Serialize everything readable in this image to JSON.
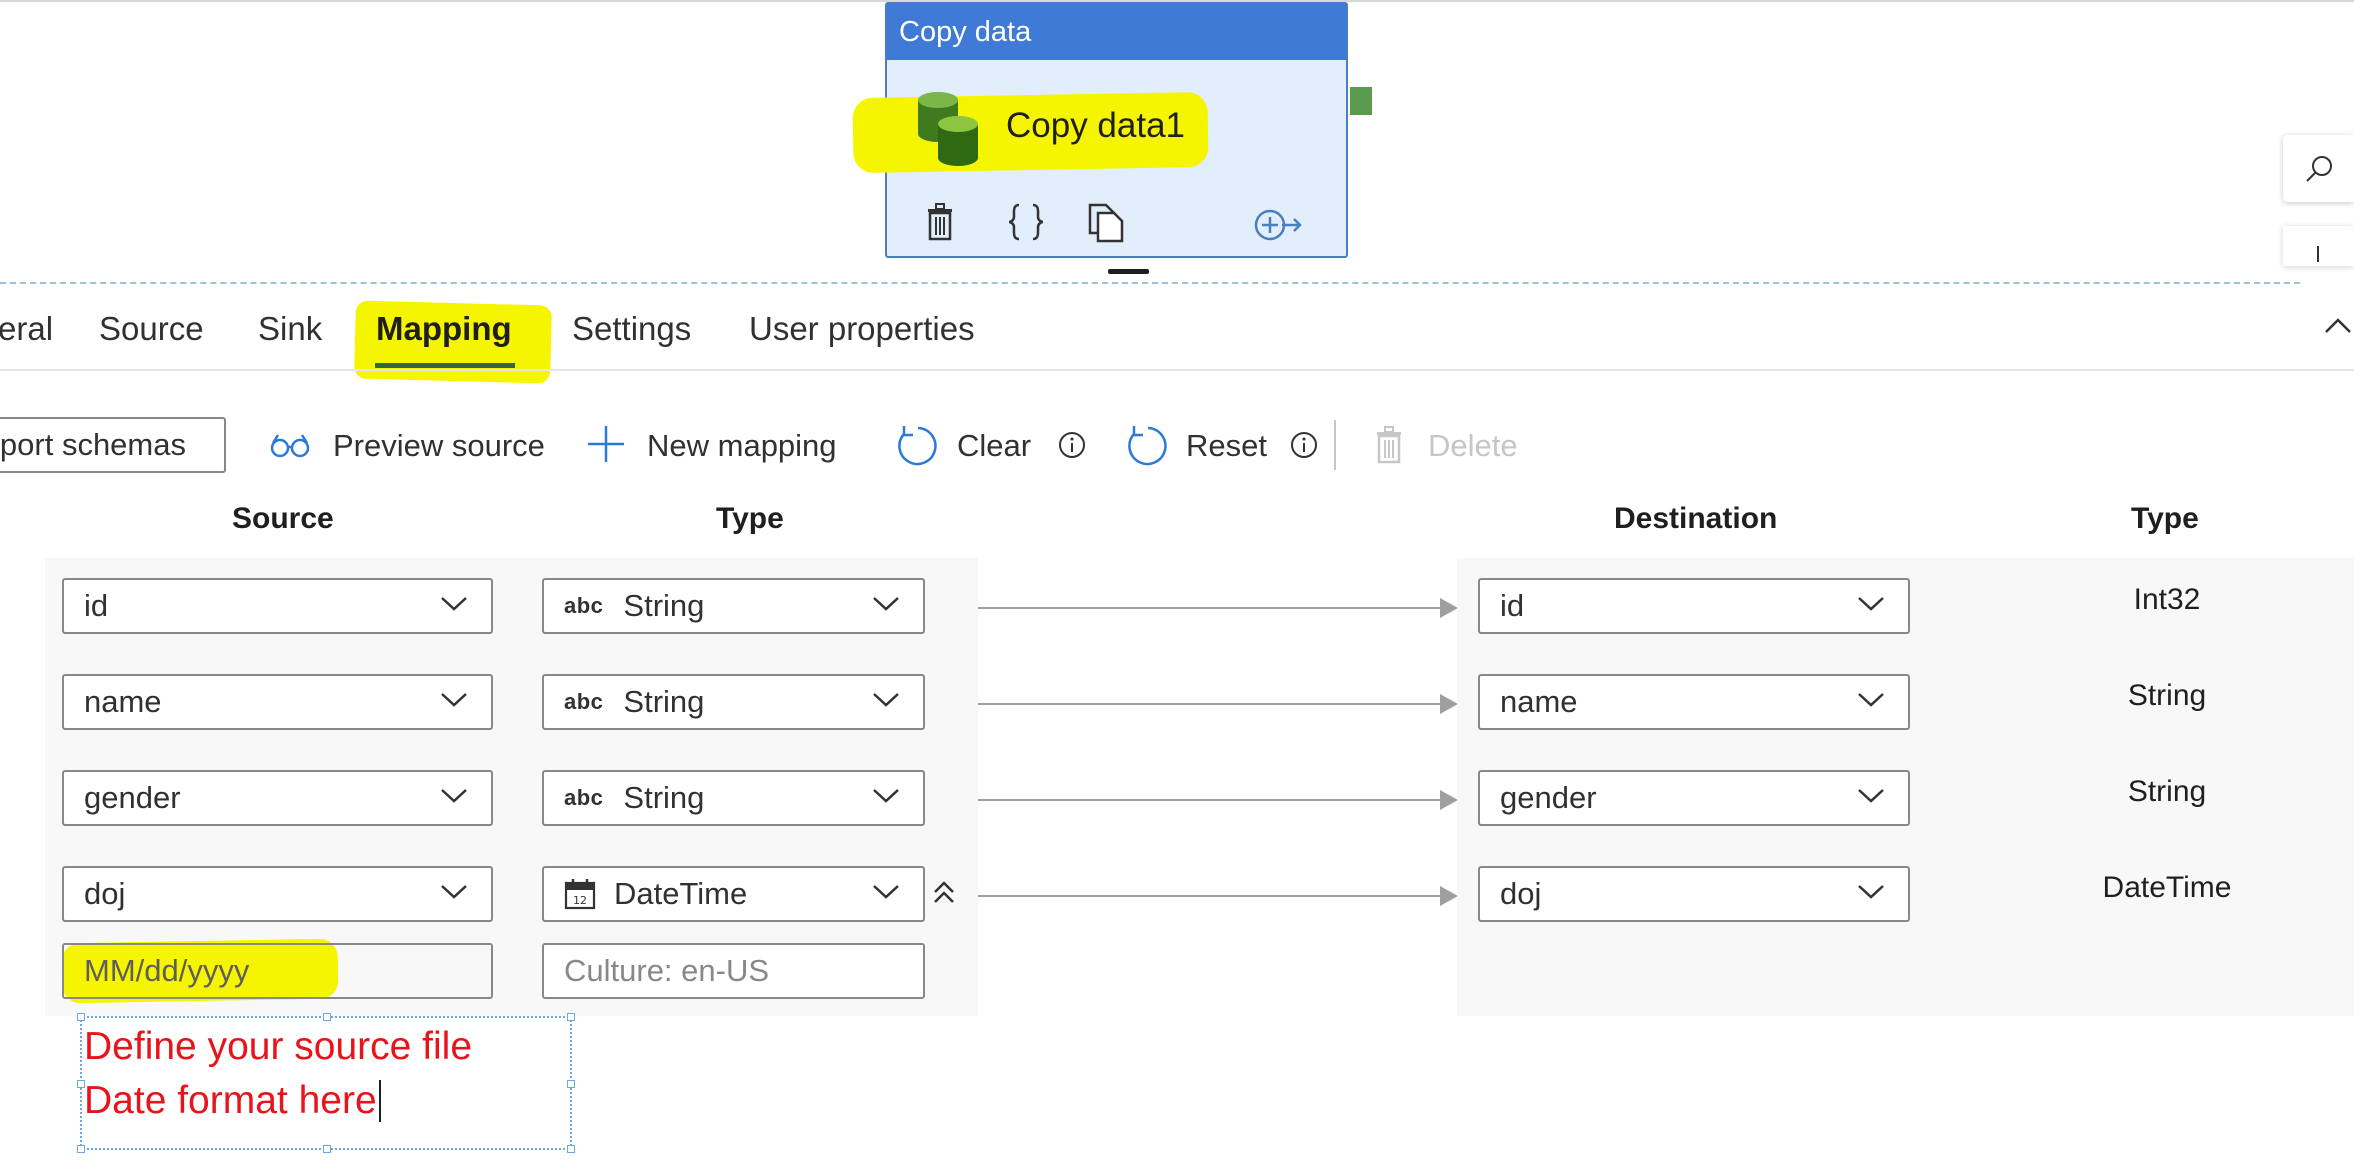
{
  "pipeline": {
    "activity": {
      "header": "Copy data",
      "name": "Copy data1",
      "tools": [
        "delete-icon",
        "code-icon",
        "clone-icon",
        "add-output-icon"
      ]
    }
  },
  "tabs": [
    {
      "label": "eral"
    },
    {
      "label": "Source"
    },
    {
      "label": "Sink"
    },
    {
      "label": "Mapping",
      "active": true
    },
    {
      "label": "Settings"
    },
    {
      "label": "User properties"
    }
  ],
  "toolbar": {
    "import_schemas": "nport schemas",
    "preview_source": "Preview source",
    "new_mapping": "New mapping",
    "clear": "Clear",
    "reset": "Reset",
    "delete": "Delete"
  },
  "columns": {
    "source": "Source",
    "source_type": "Type",
    "destination": "Destination",
    "dest_type": "Type"
  },
  "mappings": [
    {
      "source": "id",
      "type": "String",
      "type_icon": "abc",
      "destination": "id",
      "dest_type": "Int32"
    },
    {
      "source": "name",
      "type": "String",
      "type_icon": "abc",
      "destination": "name",
      "dest_type": "String"
    },
    {
      "source": "gender",
      "type": "String",
      "type_icon": "abc",
      "destination": "gender",
      "dest_type": "String"
    },
    {
      "source": "doj",
      "type": "DateTime",
      "type_icon": "calendar-icon",
      "destination": "doj",
      "dest_type": "DateTime"
    }
  ],
  "format": {
    "date_format_placeholder": "MM/dd/yyyy",
    "culture_placeholder": "Culture: en-US"
  },
  "annotation": {
    "line1": "Define your source file",
    "line2": "Date format here"
  },
  "colors": {
    "highlight": "#f5f500",
    "activity_header": "#3f7ad6",
    "activity_body": "#e2eefb",
    "annotation_red": "#e8141b"
  }
}
